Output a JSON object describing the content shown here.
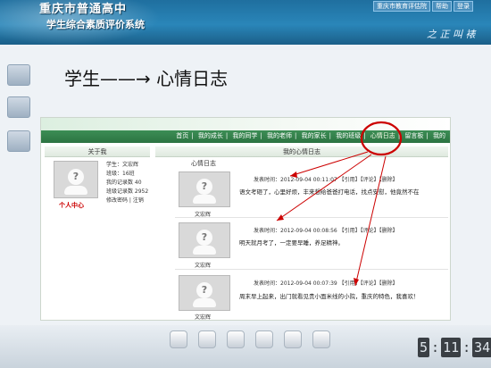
{
  "banner": {
    "title": "重庆市普通高中",
    "subtitle": "学生综合素质评价系统",
    "links": [
      "重庆市教育评估院",
      "帮助",
      "登录"
    ],
    "logo_text": "之 正 叫 裱"
  },
  "slide_title": "学生——→ 心情日志",
  "nav": {
    "items": [
      "首页",
      "我的成长",
      "我的同学",
      "我的老师",
      "我的家长",
      "我的班级",
      "心情日志",
      "留言板",
      "我的"
    ]
  },
  "left_panel": {
    "header": "关于我",
    "info": [
      "学生：文宏辉",
      "班级：16班",
      "我的记录数    40",
      "班级记录数    2952",
      "修改密码  |  注销"
    ],
    "personal_center": "个人中心"
  },
  "main_panel": {
    "header": "我的心情日志",
    "sub_header": "心情日志",
    "entries": [
      {
        "name": "文宏辉",
        "meta": "发表时间：2012-09-04   00:11:07  【引用】【评论】【删除】",
        "text": "语文考砸了，心里好烦，丰来想给爸爸打电话，找点安慰，他竟然不在"
      },
      {
        "name": "文宏辉",
        "meta": "发表时间：2012-09-04   00:08:56  【引用】【评论】【删除】",
        "text": "明天就月考了，一定要早睡，养足精神。"
      },
      {
        "name": "文宏辉",
        "meta": "发表时间：2012-09-04   00:07:39  【引用】【评论】【删除】",
        "text": "周末早上起来，出门就看见贵小面米线的小院，重庆的特色，我喜欢！"
      }
    ]
  },
  "taskbar": {
    "labels": [
      "",
      "",
      "",
      "",
      "",
      ""
    ],
    "clock": [
      "5",
      "11",
      "34"
    ]
  },
  "colors": {
    "nav_green": "#2c7342",
    "annotation_red": "#cc0000",
    "banner_blue": "#2a86b9"
  }
}
